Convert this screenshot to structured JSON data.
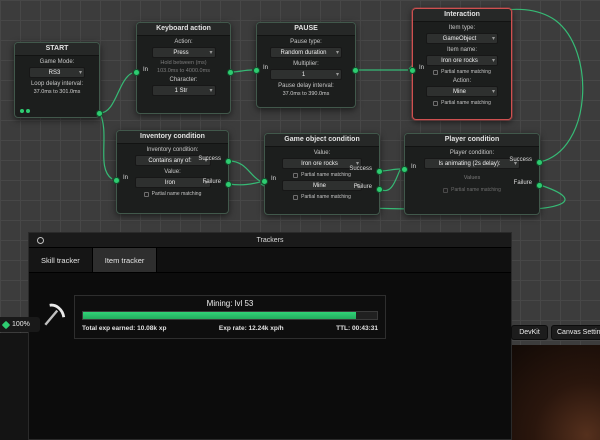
{
  "canvas": {
    "zoom_label": "100%"
  },
  "colors": {
    "accent_green": "#2ecc71",
    "selected_red": "#cf5050"
  },
  "nodes": {
    "start": {
      "title": "START",
      "game_mode_label": "Game Mode:",
      "game_mode_value": "RS3",
      "loop_delay_label": "Loop delay interval:",
      "loop_delay_value": "37.0ms to 301.0ms"
    },
    "keyboard": {
      "title": "Keyboard action",
      "in_label": "In",
      "action_label": "Action:",
      "action_value": "Press",
      "hold_label": "Hold between (ms)",
      "hold_value": "103.0ms to 4000.0ms",
      "character_label": "Character:",
      "character_value": "1 Str"
    },
    "pause": {
      "title": "PAUSE",
      "in_label": "In",
      "pause_type_label": "Pause type:",
      "pause_type_value": "Random duration",
      "multiplier_label": "Multiplier:",
      "multiplier_value": "1",
      "delay_label": "Pause delay interval:",
      "delay_value": "37.0ms to 390.0ms"
    },
    "interaction": {
      "title": "Interaction",
      "in_label": "In",
      "item_type_label": "Item type:",
      "item_type_value": "GameObject",
      "item_name_label": "Item name:",
      "item_name_value": "Iron ore rocks",
      "partial1": "Partial name matching",
      "action_label": "Action:",
      "action_value": "Mine",
      "partial2": "Partial name matching"
    },
    "inventory": {
      "title": "Inventory condition",
      "in_label": "In",
      "success_label": "Success",
      "failure_label": "Failure",
      "condition_label": "Inventory condition:",
      "condition_value": "Contains any of:",
      "value_label": "Value:",
      "value_value": "Iron",
      "partial": "Partial name matching"
    },
    "game_object": {
      "title": "Game object condition",
      "in_label": "In",
      "success_label": "Success",
      "failure_label": "Failure",
      "value_label": "Value:",
      "value_value": "Iron ore rocks",
      "partial1": "Partial name matching",
      "action_value": "Mine",
      "partial2": "Partial name matching"
    },
    "player": {
      "title": "Player condition",
      "in_label": "In",
      "success_label": "Success",
      "failure_label": "Failure",
      "condition_label": "Player condition:",
      "condition_value": "Is animating (2s delay):",
      "values_placeholder": "Values",
      "partial": "Partial name matching"
    }
  },
  "trackers": {
    "title": "Trackers",
    "tabs": [
      {
        "label": "Skill tracker"
      },
      {
        "label": "Item tracker"
      }
    ],
    "skill": {
      "name": "Mining: lvl 53",
      "progress_pct": 93,
      "total_exp": "Total exp earned: 10.08k xp",
      "exp_rate": "Exp rate: 12.24k xp/h",
      "ttl": "TTL: 00:43:31"
    }
  },
  "toolbar": {
    "devkit": "DevKit",
    "canvas_settings": "Canvas Settings"
  }
}
